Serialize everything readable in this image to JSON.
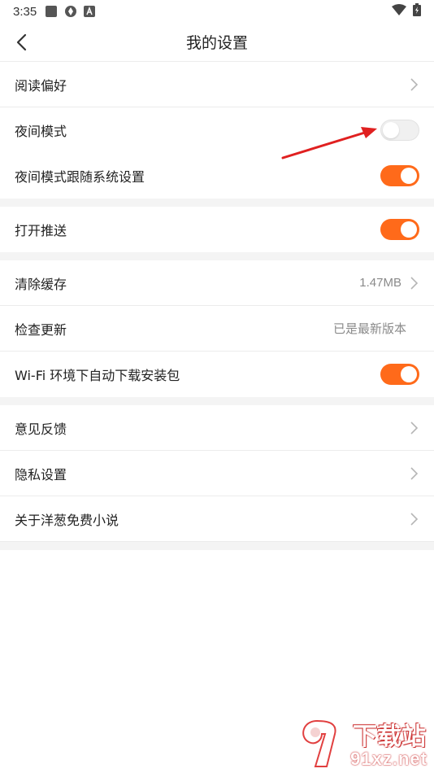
{
  "status": {
    "time": "3:35"
  },
  "header": {
    "title": "我的设置"
  },
  "sections": {
    "reading": {
      "label": "阅读偏好"
    },
    "night_mode": {
      "label": "夜间模式",
      "on": false
    },
    "night_follow": {
      "label": "夜间模式跟随系统设置",
      "on": true
    },
    "push": {
      "label": "打开推送",
      "on": true
    },
    "clear_cache": {
      "label": "清除缓存",
      "value": "1.47MB"
    },
    "check_update": {
      "label": "检查更新",
      "value": "已是最新版本"
    },
    "wifi_download": {
      "label": "Wi-Fi 环境下自动下载安装包",
      "on": true
    },
    "feedback": {
      "label": "意见反馈"
    },
    "privacy": {
      "label": "隐私设置"
    },
    "about": {
      "label": "关于洋葱免费小说"
    }
  },
  "watermark": {
    "name": "下载站",
    "site": "91xz.net"
  },
  "colors": {
    "accent": "#ff6a1a",
    "annotation": "#e02020"
  }
}
